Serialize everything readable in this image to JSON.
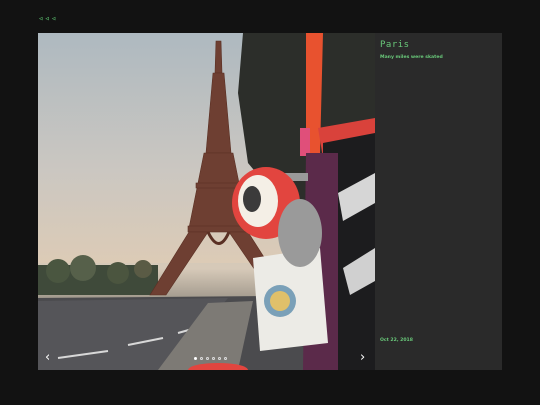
{
  "nav": {
    "back_label": "◃◃◃"
  },
  "photo": {
    "dots": [
      {
        "active": true
      },
      {
        "active": false
      },
      {
        "active": false
      },
      {
        "active": false
      },
      {
        "active": false
      },
      {
        "active": false
      }
    ],
    "prev_label": "‹",
    "next_label": "›"
  },
  "post": {
    "title": "Paris",
    "subtitle": "Many miles were skated",
    "date": "Oct 22, 2018"
  },
  "colors": {
    "accent": "#69c97a",
    "background": "#121212",
    "panel": "#2a2a2a"
  }
}
